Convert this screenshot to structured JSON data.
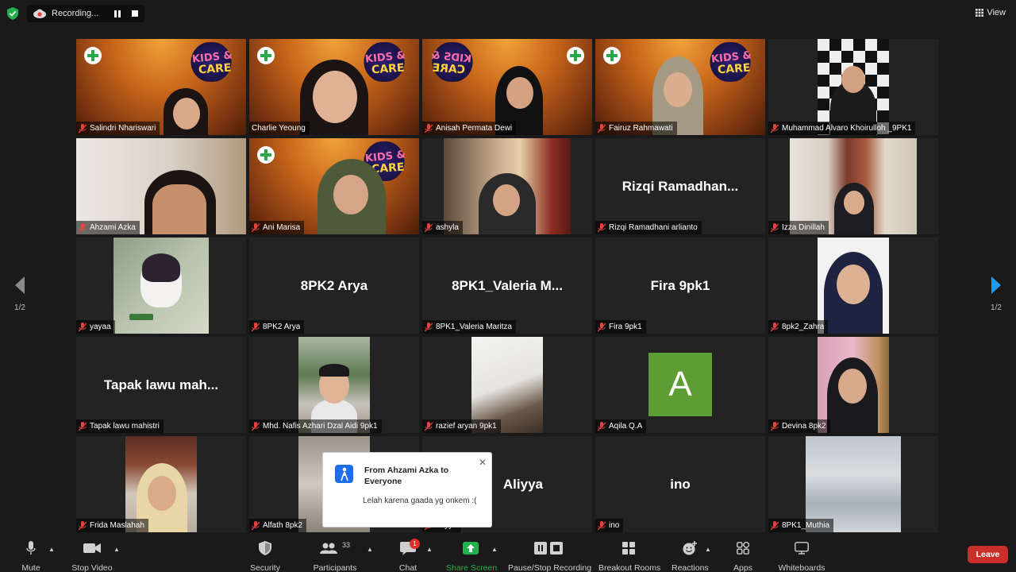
{
  "recording": {
    "label": "Recording..."
  },
  "view_button": {
    "label": "View"
  },
  "pagination": {
    "left": "1/2",
    "right": "1/2"
  },
  "participants": [
    {
      "name": "Salindri Nhariswari",
      "type": "video"
    },
    {
      "name": "Charlie Yeoung",
      "type": "video",
      "active": true
    },
    {
      "name": "Anisah Permata Dewi",
      "type": "video"
    },
    {
      "name": "Fairuz Rahmawati",
      "type": "video"
    },
    {
      "name": "Muhammad Alvaro Khoirulloh _9PK1",
      "type": "video"
    },
    {
      "name": "Ahzami Azka",
      "type": "video"
    },
    {
      "name": "Ani Marisa",
      "type": "video"
    },
    {
      "name": "ashyla",
      "type": "video"
    },
    {
      "name": "Rizqi Ramadhani arlianto",
      "display": "Rizqi  Ramadhan...",
      "type": "name"
    },
    {
      "name": "Izza Dinillah",
      "type": "video"
    },
    {
      "name": "yayaa",
      "type": "video"
    },
    {
      "name": "8PK2 Arya",
      "display": "8PK2 Arya",
      "type": "name"
    },
    {
      "name": "8PK1_Valeria Maritza",
      "display": "8PK1_Valeria  M...",
      "type": "name"
    },
    {
      "name": "Fira 9pk1",
      "display": "Fira 9pk1",
      "type": "name"
    },
    {
      "name": "8pk2_Zahra",
      "type": "video"
    },
    {
      "name": "Tapak lawu mahistri",
      "display": "Tapak  lawu  mah...",
      "type": "name"
    },
    {
      "name": "Mhd. Nafis Azhari Dzal Aidi 9pk1",
      "type": "video"
    },
    {
      "name": "razief aryan 9pk1",
      "type": "video"
    },
    {
      "name": "Aqila Q.A",
      "avatar_letter": "A",
      "type": "avatar"
    },
    {
      "name": "Devina 8pk2",
      "type": "video"
    },
    {
      "name": "Frida Maslahah",
      "type": "video"
    },
    {
      "name": "Alfath 8pk2",
      "type": "video"
    },
    {
      "name": "Aliyya",
      "display": "Aliyya",
      "type": "name"
    },
    {
      "name": "ino",
      "display": "ino",
      "type": "name"
    },
    {
      "name": "8PK1_Muthia",
      "type": "video"
    }
  ],
  "chat_popup": {
    "title": "From Ahzami Azka to Everyone",
    "message": "Lelah karena gaada yg onkem :("
  },
  "toolbar": {
    "mute": "Mute",
    "stop_video": "Stop Video",
    "security": "Security",
    "participants": "Participants",
    "participants_count": "33",
    "chat": "Chat",
    "chat_badge": "1",
    "share_screen": "Share Screen",
    "pause_stop_recording": "Pause/Stop Recording",
    "breakout_rooms": "Breakout Rooms",
    "reactions": "Reactions",
    "apps": "Apps",
    "whiteboards": "Whiteboards",
    "leave": "Leave"
  },
  "colors": {
    "background": "#1a1a1a",
    "tile": "#232323",
    "active_outline": "#d4e37a",
    "share_green": "#23b14d",
    "leave_red": "#c9302c",
    "avatar_green": "#5e9d34"
  }
}
